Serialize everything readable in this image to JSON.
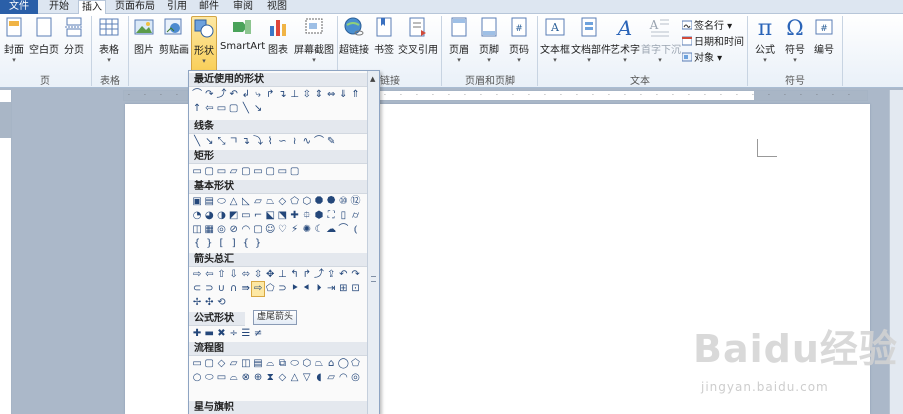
{
  "menu_tabs": [
    "文件",
    "开始",
    "插入",
    "页面布局",
    "引用",
    "邮件",
    "审阅",
    "视图"
  ],
  "ribbon": {
    "pages": {
      "cover": "封面",
      "blank": "空白页",
      "break": "分页",
      "group": "页"
    },
    "tables": {
      "table": "表格",
      "group": "表格"
    },
    "illustrations": {
      "picture": "图片",
      "clipart": "剪贴画",
      "shapes": "形状",
      "smartart": "SmartArt",
      "chart": "图表",
      "screenshot": "屏幕截图"
    },
    "links": {
      "hyperlink": "超链接",
      "bookmark": "书签",
      "crossref": "交叉引用",
      "group": "链接"
    },
    "header_footer": {
      "header": "页眉",
      "footer": "页脚",
      "pagenum": "页码",
      "group": "页眉和页脚"
    },
    "text": {
      "textbox": "文本框",
      "quickparts": "文档部件",
      "wordart": "艺术字",
      "dropcap": "首字下沉",
      "signature": "签名行",
      "datetime": "日期和时间",
      "object": "对象",
      "group": "文本"
    },
    "symbols": {
      "equation": "公式",
      "symbol": "符号",
      "number": "编号",
      "group": "符号"
    }
  },
  "shapes_panel": {
    "sections": {
      "recent": "最近使用的形状",
      "lines": "线条",
      "rect": "矩形",
      "basic": "基本形状",
      "arrows": "箭头总汇",
      "equation": "公式形状",
      "flowchart": "流程图",
      "stars": "星与旗帜"
    },
    "tooltip": "虚尾箭头"
  },
  "watermark": {
    "brand": "Baidu经验",
    "sub": "jingyan.baidu.com"
  },
  "icons": {
    "cover": "cover-page-icon",
    "blank": "blank-page-icon",
    "break": "page-break-icon",
    "table": "table-icon",
    "picture": "picture-icon",
    "clipart": "clipart-icon",
    "shapes": "shapes-icon",
    "smartart": "smartart-icon",
    "chart": "chart-icon",
    "screenshot": "screenshot-icon",
    "hyperlink": "globe-link-icon",
    "bookmark": "bookmark-icon",
    "crossref": "cross-reference-icon",
    "header": "header-icon",
    "footer": "footer-icon",
    "pagenum": "page-number-icon",
    "textbox": "textbox-icon",
    "quickparts": "quick-parts-icon",
    "wordart": "wordart-icon",
    "dropcap": "drop-cap-icon",
    "equation": "pi-icon",
    "symbol": "omega-icon",
    "number": "numbering-icon"
  },
  "colors": {
    "file_tab": "#2a5fa8",
    "selected": "#f9cf59",
    "ribbon_bg": "#eef3f9",
    "workspace": "#abb8c9"
  }
}
